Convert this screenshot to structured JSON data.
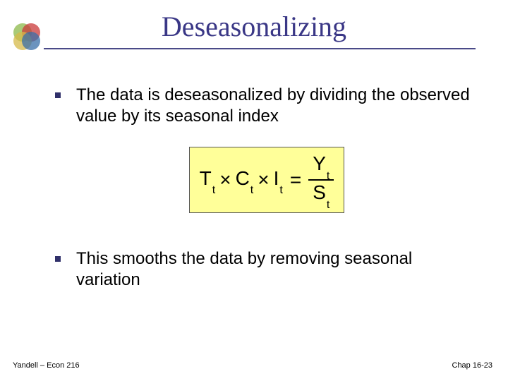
{
  "title": "Deseasonalizing",
  "bullets": [
    "The data is deseasonalized by dividing the observed value by its seasonal index",
    "This smooths the data by removing seasonal variation"
  ],
  "formula": {
    "lhs_terms": [
      {
        "base": "T",
        "sub": "t"
      },
      {
        "base": "C",
        "sub": "t"
      },
      {
        "base": "I",
        "sub": "t"
      }
    ],
    "rhs_num": {
      "base": "Y",
      "sub": "t"
    },
    "rhs_den": {
      "base": "S",
      "sub": "t"
    },
    "times": "×",
    "eq": "="
  },
  "footer": {
    "left": "Yandell – Econ 216",
    "right": "Chap 16-23"
  },
  "logo_colors": {
    "c1": "#8cb84a",
    "c2": "#c93a3a",
    "c3": "#d6b94a",
    "c4": "#3a6fa8"
  }
}
